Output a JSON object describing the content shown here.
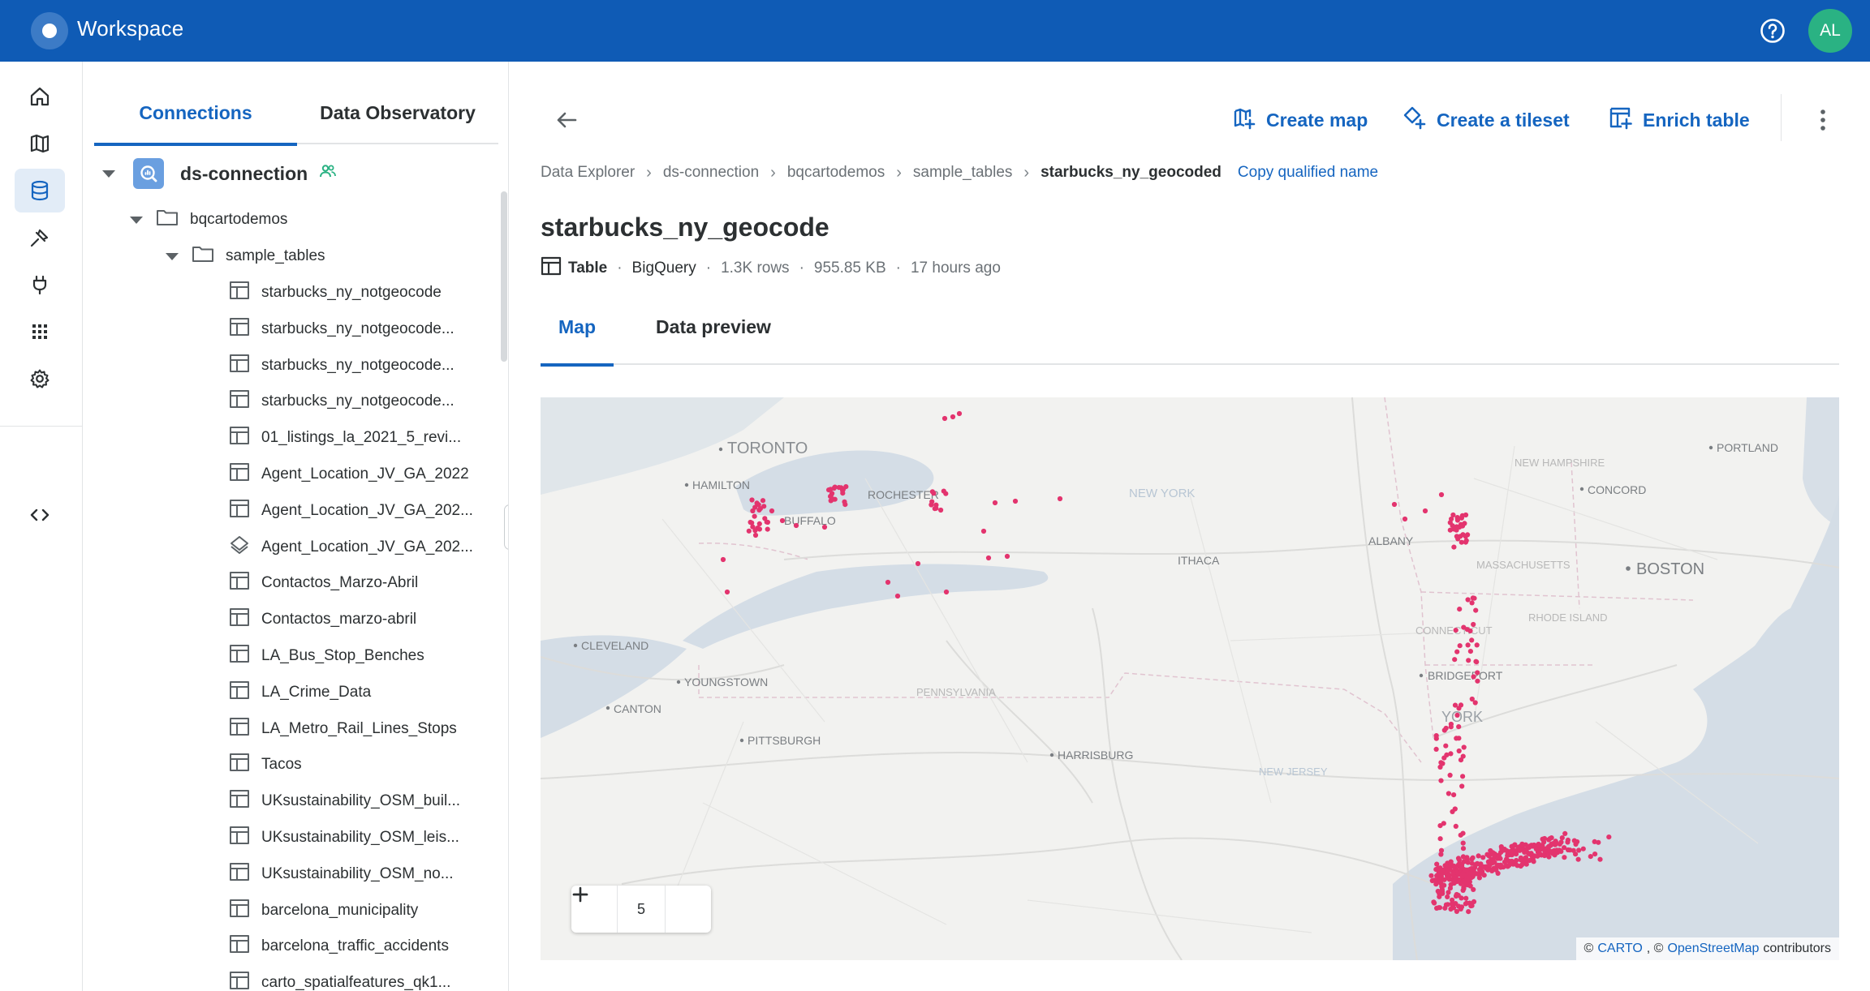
{
  "app": {
    "title": "Workspace",
    "user_initials": "AL"
  },
  "explorer": {
    "tabs": [
      "Connections",
      "Data Observatory"
    ],
    "connection": {
      "name": "ds-connection"
    },
    "project": "bqcartodemos",
    "dataset": "sample_tables",
    "tables": [
      {
        "name": "starbucks_ny_notgeocode",
        "kind": "table"
      },
      {
        "name": "starbucks_ny_notgeocode...",
        "kind": "table"
      },
      {
        "name": "starbucks_ny_notgeocode...",
        "kind": "table"
      },
      {
        "name": "starbucks_ny_notgeocode...",
        "kind": "table"
      },
      {
        "name": "01_listings_la_2021_5_revi...",
        "kind": "table"
      },
      {
        "name": "Agent_Location_JV_GA_2022",
        "kind": "table"
      },
      {
        "name": "Agent_Location_JV_GA_202...",
        "kind": "table"
      },
      {
        "name": "Agent_Location_JV_GA_202...",
        "kind": "tileset"
      },
      {
        "name": "Contactos_Marzo-Abril",
        "kind": "table"
      },
      {
        "name": "Contactos_marzo-abril",
        "kind": "table"
      },
      {
        "name": "LA_Bus_Stop_Benches",
        "kind": "table"
      },
      {
        "name": "LA_Crime_Data",
        "kind": "table"
      },
      {
        "name": "LA_Metro_Rail_Lines_Stops",
        "kind": "table"
      },
      {
        "name": "Tacos",
        "kind": "table"
      },
      {
        "name": "UKsustainability_OSM_buil...",
        "kind": "table"
      },
      {
        "name": "UKsustainability_OSM_leis...",
        "kind": "table"
      },
      {
        "name": "UKsustainability_OSM_no...",
        "kind": "table"
      },
      {
        "name": "barcelona_municipality",
        "kind": "table"
      },
      {
        "name": "barcelona_traffic_accidents",
        "kind": "table"
      },
      {
        "name": "carto_spatialfeatures_qk1...",
        "kind": "table"
      }
    ]
  },
  "actions": {
    "create_map": "Create map",
    "create_tileset": "Create a tileset",
    "enrich_table": "Enrich table"
  },
  "breadcrumb": {
    "items": [
      "Data Explorer",
      "ds-connection",
      "bqcartodemos",
      "sample_tables"
    ],
    "current": "starbucks_ny_geocoded",
    "copy_label": "Copy qualified name"
  },
  "table": {
    "title": "starbucks_ny_geocode",
    "type": "Table",
    "source": "BigQuery",
    "rows": "1.3K rows",
    "size": "955.85 KB",
    "updated": "17 hours ago"
  },
  "content_tabs": [
    "Map",
    "Data preview"
  ],
  "map": {
    "zoom": "5",
    "point_color": "#e3346e",
    "water_color": "#d4dde6",
    "labels": [
      "TORONTO",
      "HAMILTON",
      "ROCHESTER",
      "BUFFALO",
      "NEW YORK",
      "ALBANY",
      "ITHACA",
      "NEW HAMPSHIRE",
      "PORTLAND",
      "CONCORD",
      "MASSACHUSETTS",
      "BOSTON",
      "RHODE ISLAND",
      "CONNECTICUT",
      "CLEVELAND",
      "YOUNGSTOWN",
      "CANTON",
      "PENNSYLVANIA",
      "PITTSBURGH",
      "HARRISBURG",
      "BRIDGEPORT",
      "NEW JERSEY",
      "YORK"
    ],
    "attribution": {
      "prefix": "©",
      "carto": "CARTO",
      "mid": ", ©",
      "osm": "OpenStreetMap",
      "suffix": "contributors"
    }
  }
}
